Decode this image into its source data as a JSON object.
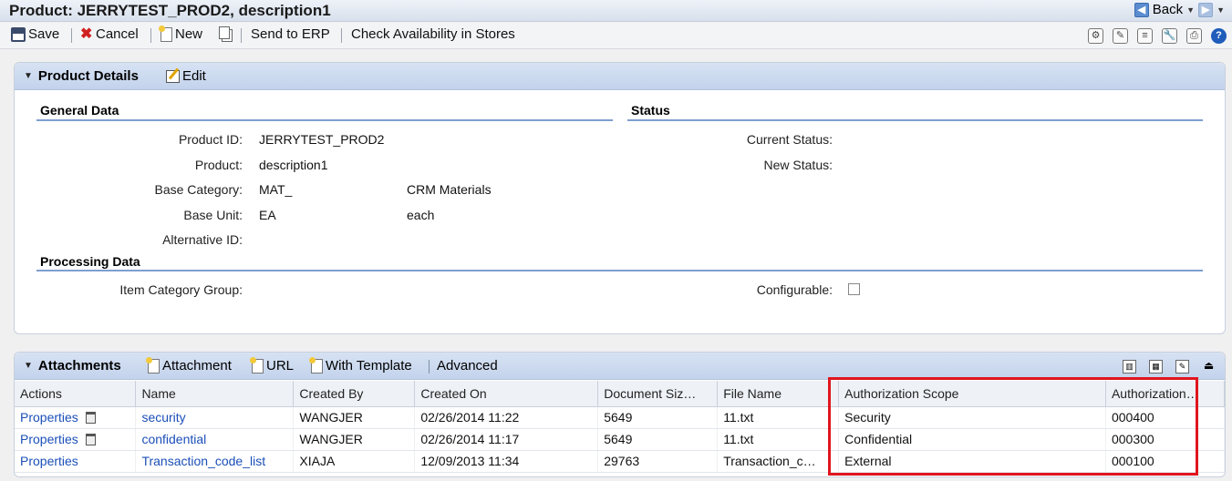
{
  "window": {
    "title": "Product: JERRYTEST_PROD2, description1",
    "back_label": "Back"
  },
  "toolbar": {
    "save": "Save",
    "cancel": "Cancel",
    "new": "New",
    "send_to_erp": "Send to ERP",
    "check_availability": "Check Availability in Stores"
  },
  "product_details": {
    "title": "Product Details",
    "edit": "Edit",
    "general_data": {
      "heading": "General Data",
      "product_id_label": "Product ID:",
      "product_id": "JERRYTEST_PROD2",
      "product_label": "Product:",
      "product": "description1",
      "base_category_label": "Base Category:",
      "base_category": "MAT_",
      "base_category_desc": "CRM Materials",
      "base_unit_label": "Base Unit:",
      "base_unit": "EA",
      "base_unit_desc": "each",
      "alternative_id_label": "Alternative ID:"
    },
    "status": {
      "heading": "Status",
      "current_status_label": "Current Status:",
      "new_status_label": "New Status:"
    },
    "processing_data": {
      "heading": "Processing Data",
      "item_category_group_label": "Item Category Group:",
      "configurable_label": "Configurable:",
      "configurable_checked": false
    }
  },
  "attachments": {
    "title": "Attachments",
    "attachment": "Attachment",
    "url": "URL",
    "with_template": "With Template",
    "advanced": "Advanced",
    "columns": [
      "Actions",
      "Name",
      "Created By",
      "Created On",
      "Document Siz…",
      "File Name",
      "Authorization Scope",
      "Authorization…"
    ],
    "rows": [
      {
        "action": "Properties",
        "name": "security",
        "created_by": "WANGJER",
        "created_on": "02/26/2014 11:22",
        "size": "5649",
        "file": "11.txt",
        "scope": "Security",
        "auth": "000400"
      },
      {
        "action": "Properties",
        "name": "confidential",
        "created_by": "WANGJER",
        "created_on": "02/26/2014 11:17",
        "size": "5649",
        "file": "11.txt",
        "scope": "Confidential",
        "auth": "000300"
      },
      {
        "action": "Properties",
        "name": "Transaction_code_list",
        "created_by": "XIAJA",
        "created_on": "12/09/2013 11:34",
        "size": "29763",
        "file": "Transaction_c…",
        "scope": "External",
        "auth": "000100"
      }
    ]
  }
}
